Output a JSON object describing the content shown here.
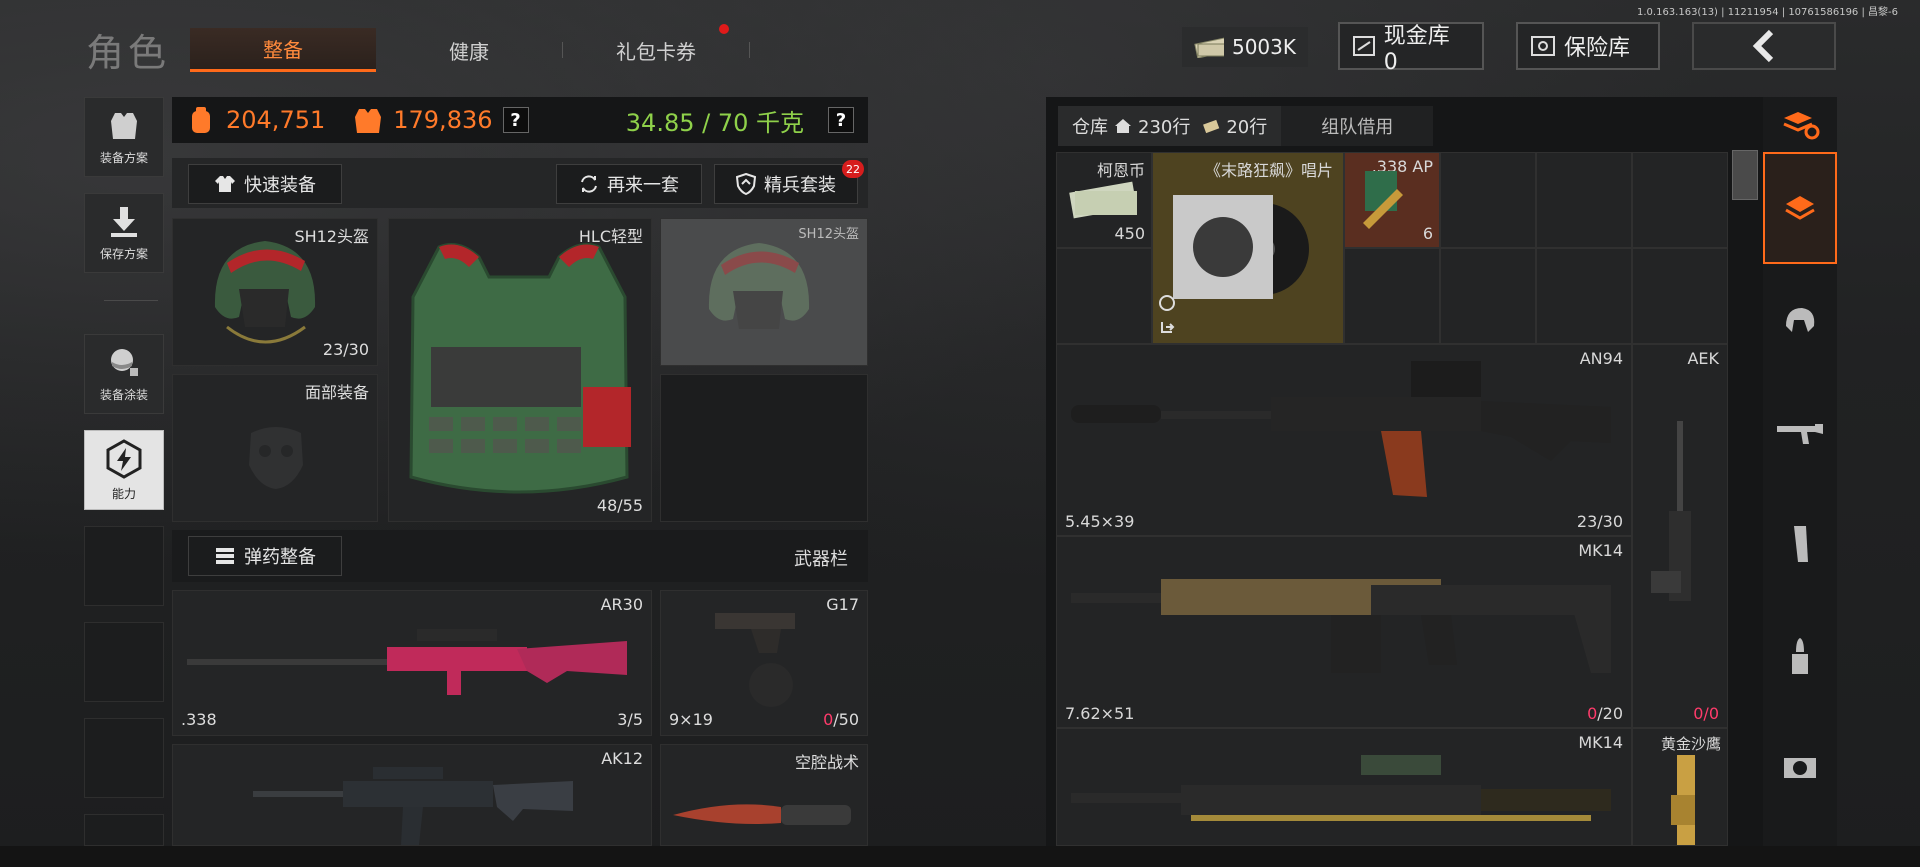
{
  "version": "1.0.163.163(13) | 11211954 | 10761586196 | 昌黎-6",
  "brand": "角色",
  "tabs": [
    {
      "label": "整备",
      "active": true
    },
    {
      "label": "健康",
      "active": false
    },
    {
      "label": "礼包卡券",
      "active": false
    }
  ],
  "top": {
    "cash": "5003K",
    "cash_vault": "现金库 0",
    "safe": "保险库"
  },
  "sidebar": [
    {
      "label": "装备方案",
      "icon": "vest-icon"
    },
    {
      "label": "保存方案",
      "icon": "download-icon"
    },
    {
      "label": "装备涂装",
      "icon": "paint-icon"
    },
    {
      "label": "能力",
      "icon": "lightning-icon"
    }
  ],
  "stats": {
    "value_a": "204,751",
    "value_b": "179,836",
    "weight": "34.85 / 70 千克",
    "help": "?"
  },
  "actions": {
    "quick_equip": "快速装备",
    "again": "再来一套",
    "elite": "精兵套装",
    "elite_badge": "22",
    "ammo_equip": "弹药整备",
    "weapon_bar": "武器栏"
  },
  "gear": {
    "helmet": {
      "name": "SH12头盔",
      "count": "23/30"
    },
    "face": {
      "name": "面部装备"
    },
    "armor": {
      "name": "HLC轻型",
      "count": "48/55"
    },
    "helmet_ghost": {
      "name": "SH12头盔"
    }
  },
  "weapons": {
    "w1": {
      "name": "AR30",
      "caliber": ".338",
      "count": "3/5"
    },
    "w2": {
      "name": "G17",
      "caliber": "9×19",
      "count_cur": "0",
      "count_max": "/50"
    },
    "w3": {
      "name": "AK12"
    },
    "w4": {
      "name": "空腔战术"
    }
  },
  "storage": {
    "tab_warehouse": "仓库",
    "rows_a": "230行",
    "rows_b": "20行",
    "tab_team": "组队借用",
    "items": [
      {
        "name": "柯恩币",
        "count": "450"
      },
      {
        "name": "《末路狂飙》唱片"
      },
      {
        "name": ".338 AP",
        "count": "6"
      },
      {
        "name": "AN94",
        "caliber": "5.45×39",
        "count": "23/30"
      },
      {
        "name": "AEK",
        "count_cur": "0",
        "count_max": "/0"
      },
      {
        "name": "MK14",
        "caliber": "7.62×51",
        "count_cur": "0",
        "count_max": "/20"
      },
      {
        "name": "MK14"
      },
      {
        "name": "黄金沙鹰"
      }
    ]
  },
  "colors": {
    "accent": "#ff6a1a",
    "green": "#8fd14a",
    "pink": "#ff3b6b"
  }
}
